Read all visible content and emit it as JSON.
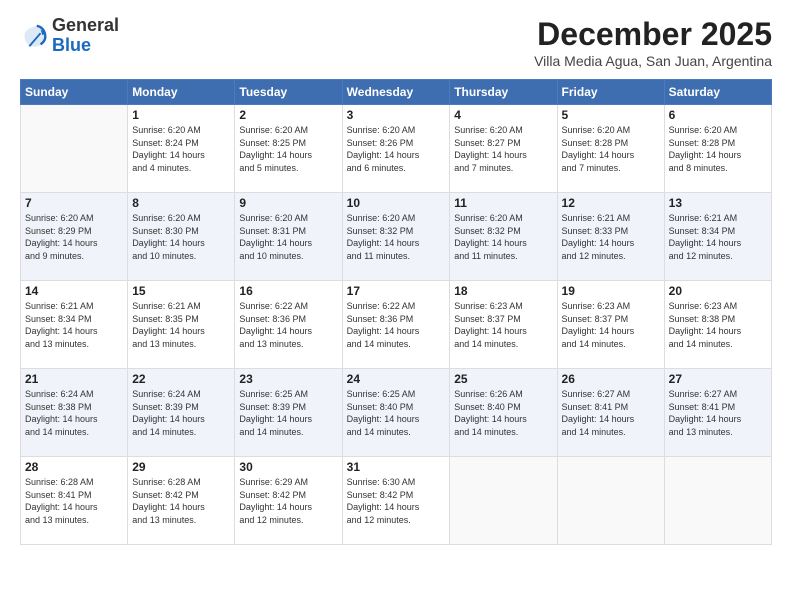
{
  "logo": {
    "general": "General",
    "blue": "Blue"
  },
  "header": {
    "month": "December 2025",
    "location": "Villa Media Agua, San Juan, Argentina"
  },
  "weekdays": [
    "Sunday",
    "Monday",
    "Tuesday",
    "Wednesday",
    "Thursday",
    "Friday",
    "Saturday"
  ],
  "weeks": [
    [
      {
        "day": "",
        "info": ""
      },
      {
        "day": "1",
        "info": "Sunrise: 6:20 AM\nSunset: 8:24 PM\nDaylight: 14 hours\nand 4 minutes."
      },
      {
        "day": "2",
        "info": "Sunrise: 6:20 AM\nSunset: 8:25 PM\nDaylight: 14 hours\nand 5 minutes."
      },
      {
        "day": "3",
        "info": "Sunrise: 6:20 AM\nSunset: 8:26 PM\nDaylight: 14 hours\nand 6 minutes."
      },
      {
        "day": "4",
        "info": "Sunrise: 6:20 AM\nSunset: 8:27 PM\nDaylight: 14 hours\nand 7 minutes."
      },
      {
        "day": "5",
        "info": "Sunrise: 6:20 AM\nSunset: 8:28 PM\nDaylight: 14 hours\nand 7 minutes."
      },
      {
        "day": "6",
        "info": "Sunrise: 6:20 AM\nSunset: 8:28 PM\nDaylight: 14 hours\nand 8 minutes."
      }
    ],
    [
      {
        "day": "7",
        "info": "Sunrise: 6:20 AM\nSunset: 8:29 PM\nDaylight: 14 hours\nand 9 minutes."
      },
      {
        "day": "8",
        "info": "Sunrise: 6:20 AM\nSunset: 8:30 PM\nDaylight: 14 hours\nand 10 minutes."
      },
      {
        "day": "9",
        "info": "Sunrise: 6:20 AM\nSunset: 8:31 PM\nDaylight: 14 hours\nand 10 minutes."
      },
      {
        "day": "10",
        "info": "Sunrise: 6:20 AM\nSunset: 8:32 PM\nDaylight: 14 hours\nand 11 minutes."
      },
      {
        "day": "11",
        "info": "Sunrise: 6:20 AM\nSunset: 8:32 PM\nDaylight: 14 hours\nand 11 minutes."
      },
      {
        "day": "12",
        "info": "Sunrise: 6:21 AM\nSunset: 8:33 PM\nDaylight: 14 hours\nand 12 minutes."
      },
      {
        "day": "13",
        "info": "Sunrise: 6:21 AM\nSunset: 8:34 PM\nDaylight: 14 hours\nand 12 minutes."
      }
    ],
    [
      {
        "day": "14",
        "info": "Sunrise: 6:21 AM\nSunset: 8:34 PM\nDaylight: 14 hours\nand 13 minutes."
      },
      {
        "day": "15",
        "info": "Sunrise: 6:21 AM\nSunset: 8:35 PM\nDaylight: 14 hours\nand 13 minutes."
      },
      {
        "day": "16",
        "info": "Sunrise: 6:22 AM\nSunset: 8:36 PM\nDaylight: 14 hours\nand 13 minutes."
      },
      {
        "day": "17",
        "info": "Sunrise: 6:22 AM\nSunset: 8:36 PM\nDaylight: 14 hours\nand 14 minutes."
      },
      {
        "day": "18",
        "info": "Sunrise: 6:23 AM\nSunset: 8:37 PM\nDaylight: 14 hours\nand 14 minutes."
      },
      {
        "day": "19",
        "info": "Sunrise: 6:23 AM\nSunset: 8:37 PM\nDaylight: 14 hours\nand 14 minutes."
      },
      {
        "day": "20",
        "info": "Sunrise: 6:23 AM\nSunset: 8:38 PM\nDaylight: 14 hours\nand 14 minutes."
      }
    ],
    [
      {
        "day": "21",
        "info": "Sunrise: 6:24 AM\nSunset: 8:38 PM\nDaylight: 14 hours\nand 14 minutes."
      },
      {
        "day": "22",
        "info": "Sunrise: 6:24 AM\nSunset: 8:39 PM\nDaylight: 14 hours\nand 14 minutes."
      },
      {
        "day": "23",
        "info": "Sunrise: 6:25 AM\nSunset: 8:39 PM\nDaylight: 14 hours\nand 14 minutes."
      },
      {
        "day": "24",
        "info": "Sunrise: 6:25 AM\nSunset: 8:40 PM\nDaylight: 14 hours\nand 14 minutes."
      },
      {
        "day": "25",
        "info": "Sunrise: 6:26 AM\nSunset: 8:40 PM\nDaylight: 14 hours\nand 14 minutes."
      },
      {
        "day": "26",
        "info": "Sunrise: 6:27 AM\nSunset: 8:41 PM\nDaylight: 14 hours\nand 14 minutes."
      },
      {
        "day": "27",
        "info": "Sunrise: 6:27 AM\nSunset: 8:41 PM\nDaylight: 14 hours\nand 13 minutes."
      }
    ],
    [
      {
        "day": "28",
        "info": "Sunrise: 6:28 AM\nSunset: 8:41 PM\nDaylight: 14 hours\nand 13 minutes."
      },
      {
        "day": "29",
        "info": "Sunrise: 6:28 AM\nSunset: 8:42 PM\nDaylight: 14 hours\nand 13 minutes."
      },
      {
        "day": "30",
        "info": "Sunrise: 6:29 AM\nSunset: 8:42 PM\nDaylight: 14 hours\nand 12 minutes."
      },
      {
        "day": "31",
        "info": "Sunrise: 6:30 AM\nSunset: 8:42 PM\nDaylight: 14 hours\nand 12 minutes."
      },
      {
        "day": "",
        "info": ""
      },
      {
        "day": "",
        "info": ""
      },
      {
        "day": "",
        "info": ""
      }
    ]
  ]
}
